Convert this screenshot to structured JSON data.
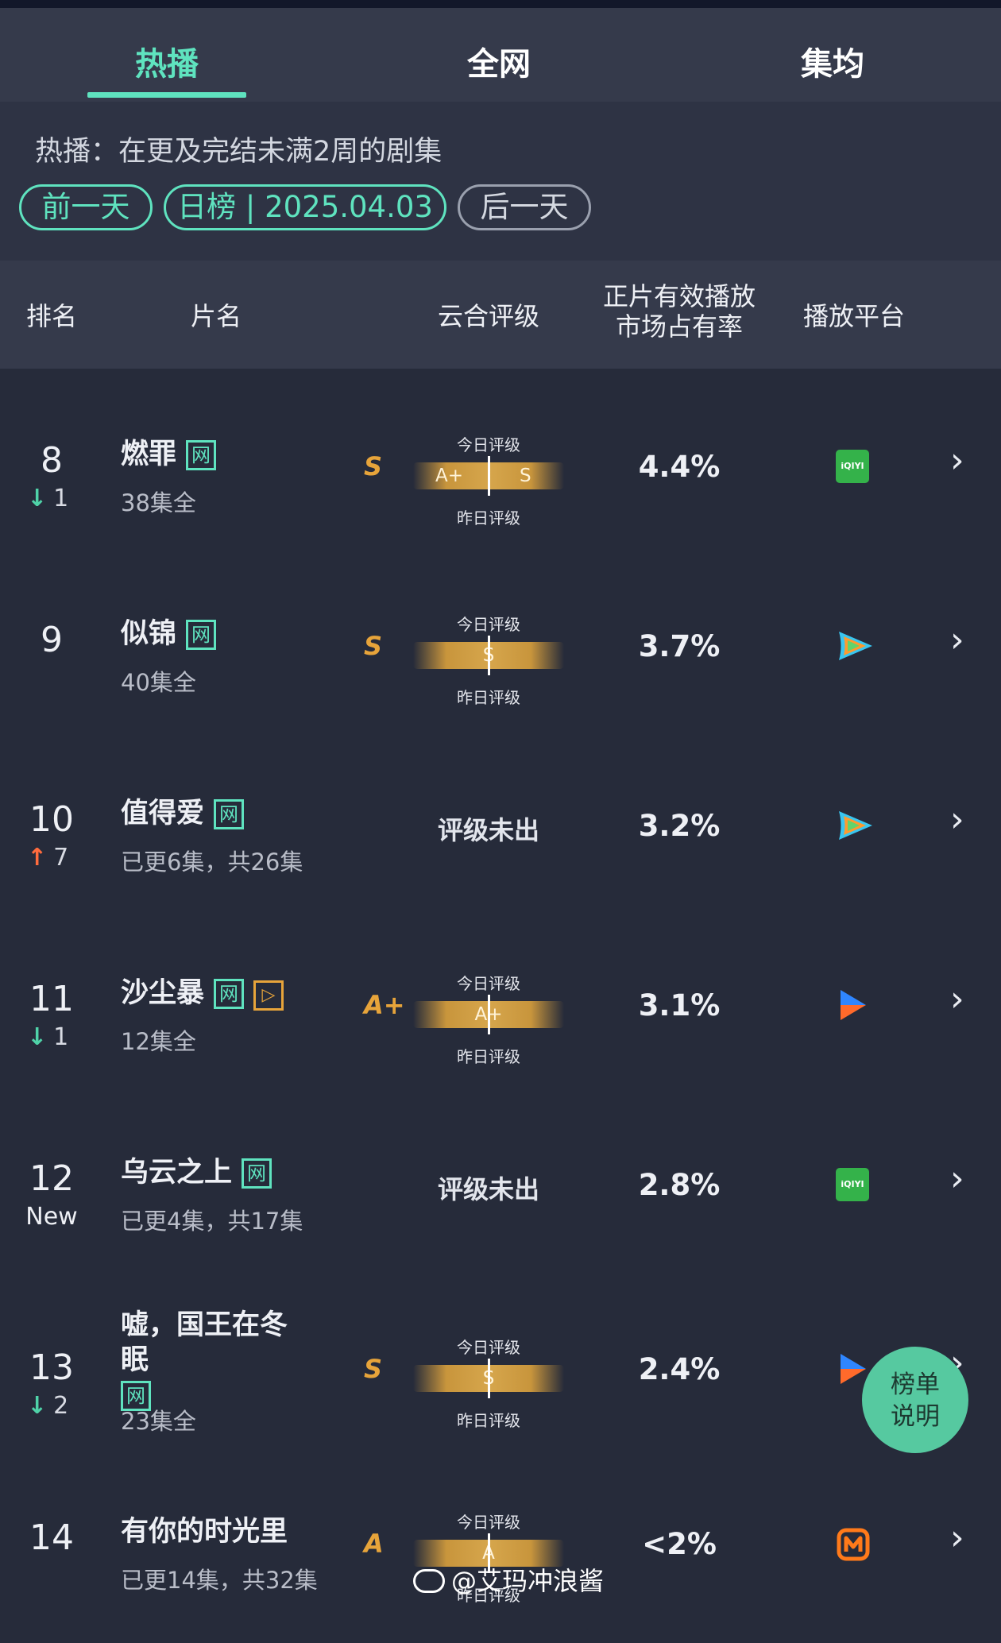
{
  "tabs": [
    {
      "label": "热播",
      "active": true
    },
    {
      "label": "全网",
      "active": false
    },
    {
      "label": "集均",
      "active": false
    }
  ],
  "filter": {
    "description": "热播：在更及完结未满2周的剧集",
    "prev_label": "前一天",
    "date_label": "日榜 | 2025.04.03",
    "next_label": "后一天"
  },
  "columns": {
    "rank": "排名",
    "title": "片名",
    "rating": "云合评级",
    "share_line1": "正片有效播放",
    "share_line2": "市场占有率",
    "platform": "播放平台"
  },
  "grade_labels": {
    "today": "今日评级",
    "yesterday": "昨日评级"
  },
  "rows": [
    {
      "rank": "8",
      "change_dir": "down",
      "change": "1",
      "title_lines": [
        "燃罪"
      ],
      "tags": [
        "网"
      ],
      "episodes": "38集全",
      "grade": "S",
      "today": "S",
      "yesterday": "A+",
      "not_rated": "",
      "share": "4.4%",
      "platform": "iqiyi"
    },
    {
      "rank": "9",
      "change_dir": "",
      "change": "",
      "title_lines": [
        "似锦"
      ],
      "tags": [
        "网"
      ],
      "episodes": "40集全",
      "grade": "S",
      "today": "S",
      "yesterday": "S",
      "not_rated": "",
      "share": "3.7%",
      "platform": "tencent"
    },
    {
      "rank": "10",
      "change_dir": "up",
      "change": "7",
      "title_lines": [
        "值得爱"
      ],
      "tags": [
        "网"
      ],
      "episodes": "已更6集，共26集",
      "grade": "",
      "today": "",
      "yesterday": "",
      "not_rated": "评级未出",
      "share": "3.2%",
      "platform": "tencent"
    },
    {
      "rank": "11",
      "change_dir": "down",
      "change": "1",
      "title_lines": [
        "沙尘暴"
      ],
      "tags": [
        "网",
        "▷"
      ],
      "episodes": "12集全",
      "grade": "A+",
      "today": "A+",
      "yesterday": "A+",
      "not_rated": "",
      "share": "3.1%",
      "platform": "youku"
    },
    {
      "rank": "12",
      "change_dir": "new",
      "change": "New",
      "title_lines": [
        "乌云之上"
      ],
      "tags": [
        "网"
      ],
      "episodes": "已更4集，共17集",
      "grade": "",
      "today": "",
      "yesterday": "",
      "not_rated": "评级未出",
      "share": "2.8%",
      "platform": "iqiyi"
    },
    {
      "rank": "13",
      "change_dir": "down",
      "change": "2",
      "title_lines": [
        "嘘，国王在冬",
        "眠"
      ],
      "tags": [
        "网"
      ],
      "episodes": "23集全",
      "grade": "S",
      "today": "S",
      "yesterday": "S",
      "not_rated": "",
      "share": "2.4%",
      "platform": "youku"
    },
    {
      "rank": "14",
      "change_dir": "",
      "change": "",
      "title_lines": [
        "有你的时光里"
      ],
      "tags": [],
      "episodes": "已更14集，共32集",
      "grade": "A",
      "today": "A",
      "yesterday": "A",
      "not_rated": "",
      "share": "<2%",
      "platform": "mango"
    }
  ],
  "icons": {
    "iqiyi_text": "iQIYI",
    "chevron": "›",
    "down_arrow": "↓",
    "up_arrow": "↑"
  },
  "fab": {
    "line1": "榜单",
    "line2": "说明"
  },
  "watermark": "@艾玛冲浪酱",
  "colors": {
    "accent": "#5fe3bf",
    "gold": "#e7a43a",
    "up": "#ff6b3d",
    "background": "#262b3a"
  }
}
